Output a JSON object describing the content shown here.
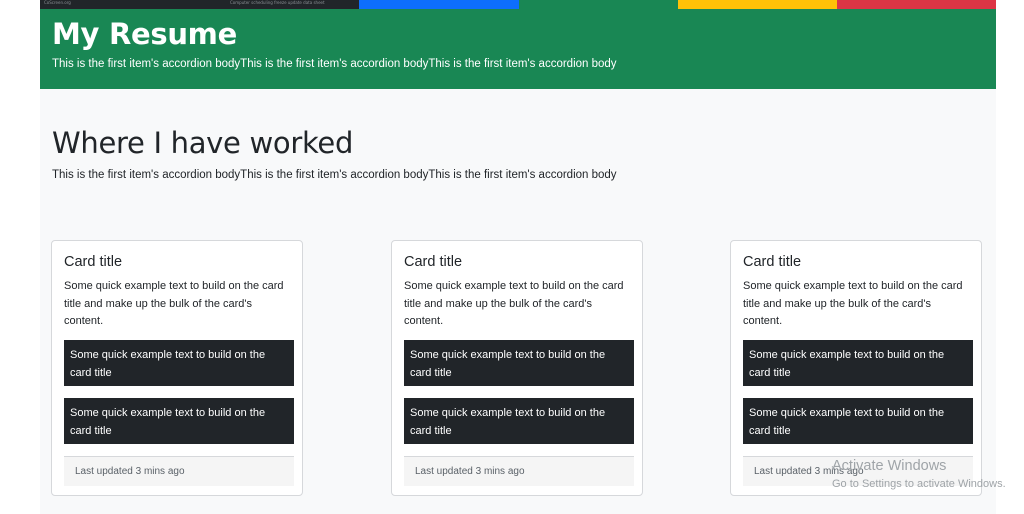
{
  "strip": {
    "tiny_left": "CoScreen.org",
    "tiny_right": "Computer scheduling freeze update data sheet"
  },
  "header": {
    "title": "My Resume",
    "subtitle": "This is the first item's accordion bodyThis is the first item's accordion bodyThis is the first item's accordion body"
  },
  "section": {
    "title": "Where I have worked",
    "subtitle": "This is the first item's accordion bodyThis is the first item's accordion bodyThis is the first item's accordion body"
  },
  "cards": [
    {
      "title": "Card title",
      "text": "Some quick example text to build on the card title and make up the bulk of the card's content.",
      "items": [
        "Some quick example text to build on the card title",
        "Some quick example text to build on the card title"
      ],
      "footer": "Last updated 3 mins ago"
    },
    {
      "title": "Card title",
      "text": "Some quick example text to build on the card title and make up the bulk of the card's content.",
      "items": [
        "Some quick example text to build on the card title",
        "Some quick example text to build on the card title"
      ],
      "footer": "Last updated 3 mins ago"
    },
    {
      "title": "Card title",
      "text": "Some quick example text to build on the card title and make up the bulk of the card's content.",
      "items": [
        "Some quick example text to build on the card title",
        "Some quick example text to build on the card title"
      ],
      "footer": "Last updated 3 mins ago"
    }
  ],
  "watermark": {
    "line1": "Activate Windows",
    "line2": "Go to Settings to activate Windows."
  },
  "colors": {
    "strip": [
      "#212529",
      "#0d6efd",
      "#198754",
      "#ffc107",
      "#dc3545"
    ],
    "header_bg": "#198754",
    "dark_item_bg": "#212529"
  }
}
